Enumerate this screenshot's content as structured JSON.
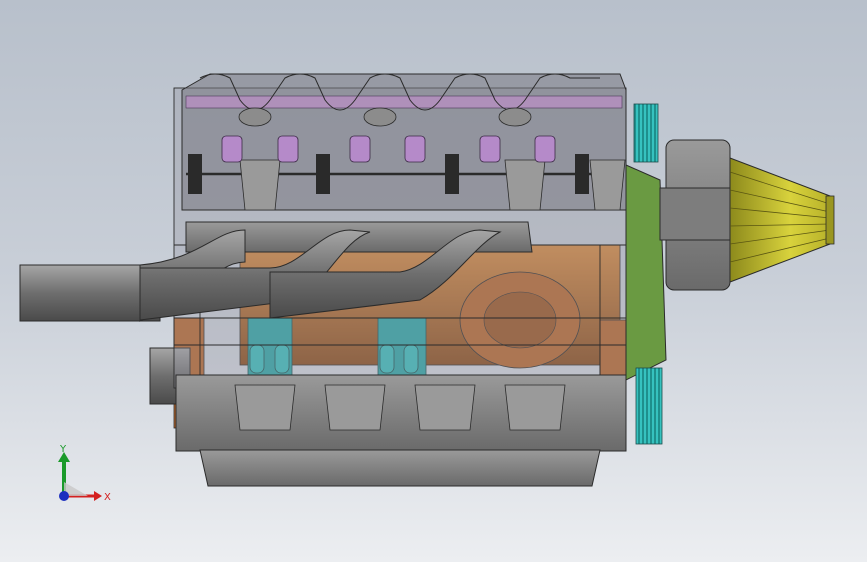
{
  "viewport": {
    "background_top": "#b8c0cb",
    "background_bottom": "#eceef1"
  },
  "colors": {
    "housing": "#8c8c8c",
    "housing_dark": "#5e5e5e",
    "pipe": "#7a7a7a",
    "copper": "#c8732a",
    "copper_dark": "#8a4a18",
    "teal": "#2aa7a6",
    "purple": "#b58ac9",
    "green_plate": "#6a9a42",
    "filter_yellow": "#c9c22c",
    "outline": "#2b2b2b"
  },
  "model": {
    "icon": "engine-assembly-icon"
  },
  "triad": {
    "y_label": "Y",
    "x_label": "X",
    "y_color": "#1a9a2a",
    "x_color": "#d42020",
    "z_color": "#1c2fbf"
  }
}
